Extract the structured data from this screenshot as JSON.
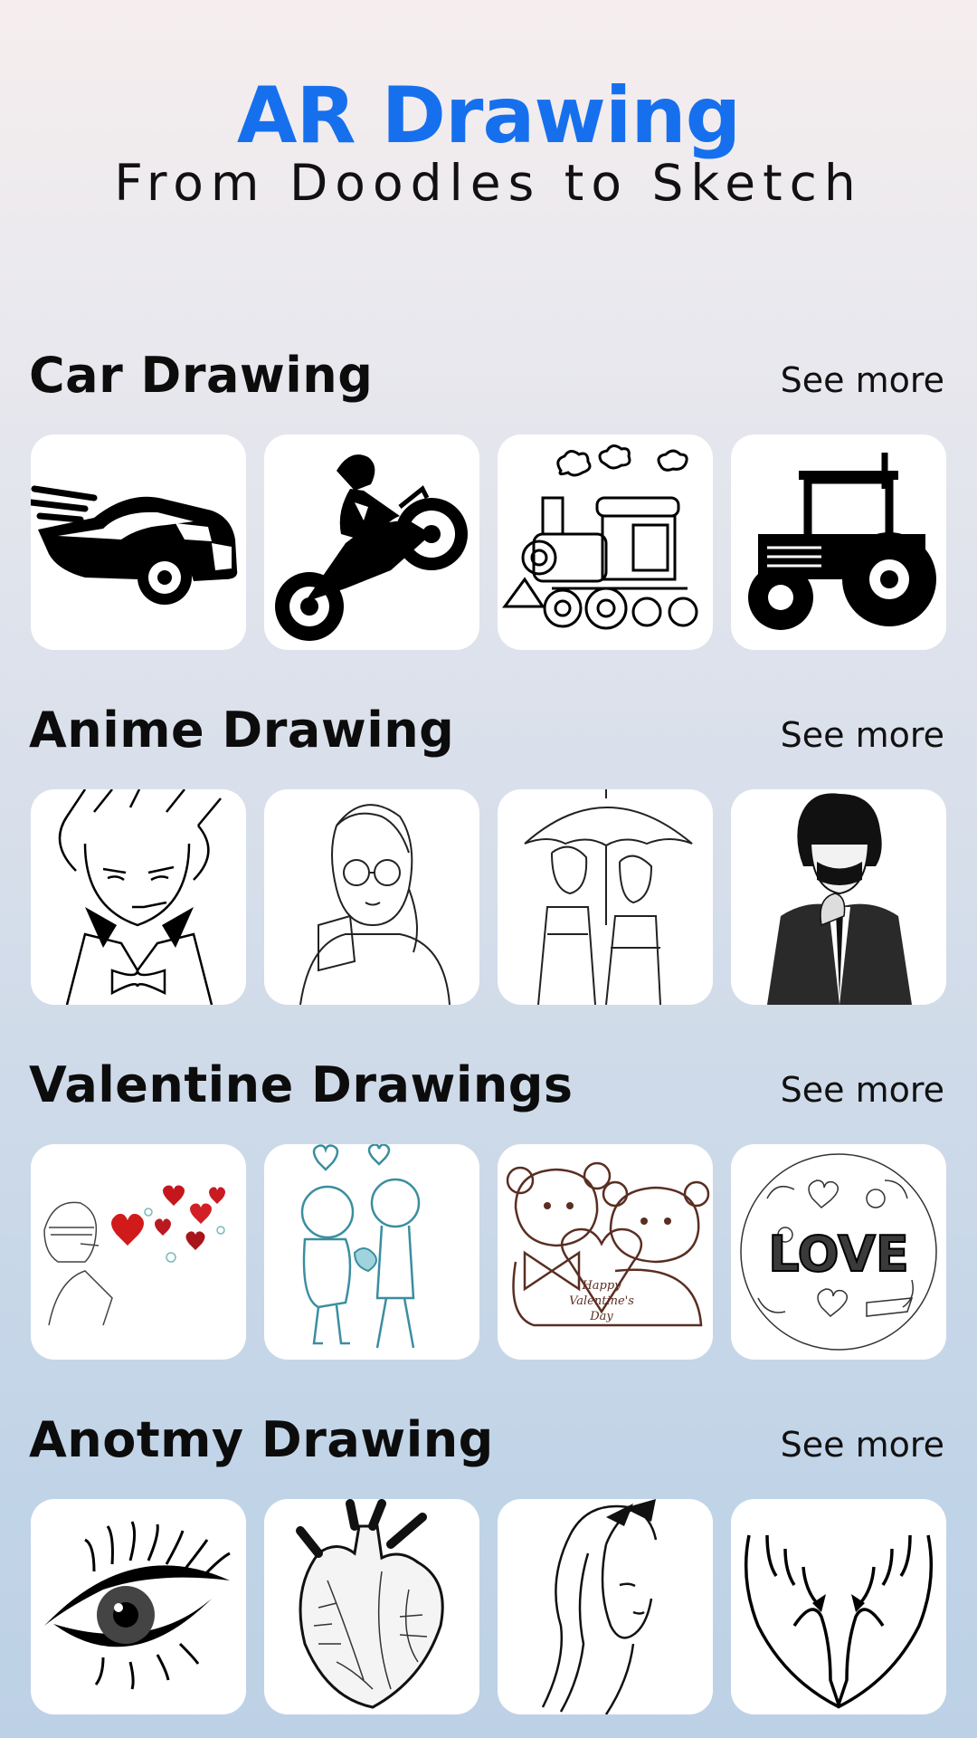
{
  "header": {
    "title": "AR Drawing",
    "subtitle": "From Doodles to Sketch"
  },
  "sections": [
    {
      "title": "Car Drawing",
      "see_more": "See more",
      "items": [
        "sports-car-icon",
        "motorcycle-rider-icon",
        "steam-train-icon",
        "tractor-icon"
      ]
    },
    {
      "title": "Anime Drawing",
      "see_more": "See more",
      "items": [
        "anime-boy-bowtie-icon",
        "anime-girl-glasses-icon",
        "anime-couple-umbrella-icon",
        "anime-boy-mask-icon"
      ]
    },
    {
      "title": "Valentine Drawings",
      "see_more": "See more",
      "items": [
        "girl-blowing-hearts-icon",
        "couple-flowers-icon",
        "teddy-bears-icon",
        "love-doodle-icon"
      ],
      "text_in_art": {
        "teddy_heart": "Happy Valentine's Day",
        "doodle_word": "LOVE"
      }
    },
    {
      "title": "Anotmy Drawing",
      "see_more": "See more",
      "items": [
        "eye-icon",
        "anatomical-heart-icon",
        "woman-portrait-icon",
        "open-hands-icon"
      ]
    }
  ],
  "colors": {
    "accent": "#1670ee",
    "text": "#111111",
    "card": "#ffffff"
  }
}
